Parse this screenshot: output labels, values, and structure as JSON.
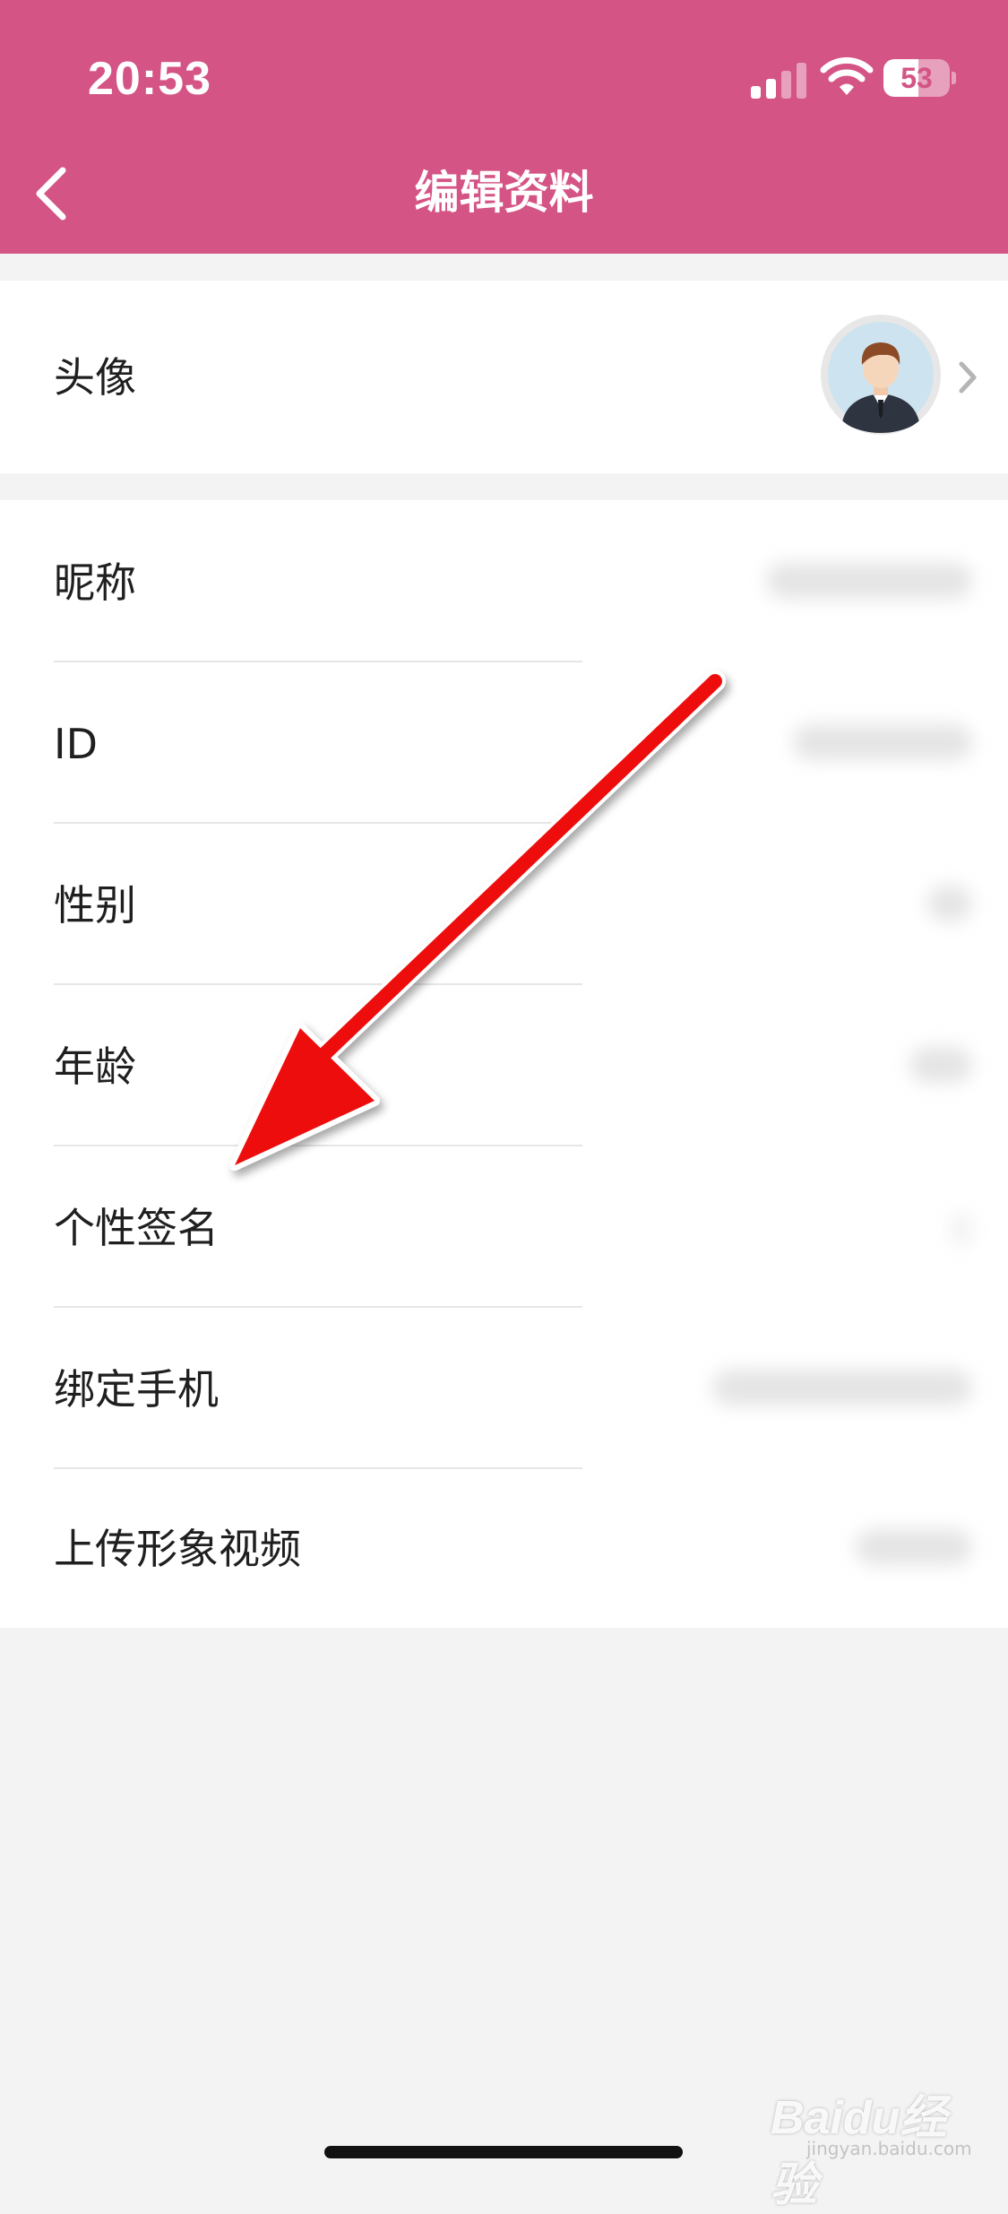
{
  "status_bar": {
    "time": "20:53",
    "battery": "53",
    "battery_level": 0.53,
    "signal_icon": "cellular-signal-icon",
    "wifi_icon": "wifi-icon"
  },
  "nav": {
    "title": "编辑资料",
    "back_icon": "chevron-left-icon"
  },
  "avatar_row": {
    "label": "头像",
    "avatar_icon": "user-avatar-icon",
    "chevron_icon": "chevron-right-icon"
  },
  "profile_rows": [
    {
      "label": "昵称"
    },
    {
      "label": "ID"
    },
    {
      "label": "性别"
    },
    {
      "label": "年龄"
    },
    {
      "label": "个性签名"
    },
    {
      "label": "绑定手机"
    },
    {
      "label": "上传形象视频"
    }
  ],
  "overlay": {
    "arrow_icon": "red-arrow-annotation-icon"
  },
  "watermark": {
    "brand": "Baidu经验",
    "site": "jingyan.baidu.com"
  },
  "colors": {
    "header": "#d45485",
    "background": "#f3f3f3",
    "card": "#ffffff",
    "arrow": "#ee1111"
  }
}
